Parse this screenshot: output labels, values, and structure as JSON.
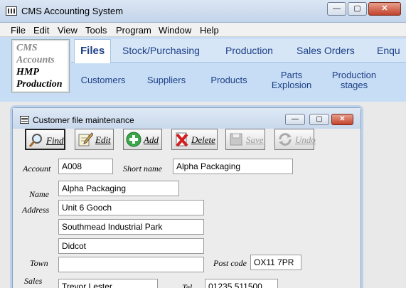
{
  "window": {
    "title": "CMS Accounting System",
    "controls": {
      "minimize": "—",
      "maximize": "▢",
      "close": "✕"
    }
  },
  "menu": [
    "File",
    "Edit",
    "View",
    "Tools",
    "Program",
    "Window",
    "Help"
  ],
  "logo": {
    "line1": "CMS",
    "line2": "Accounts",
    "line3": "HMP",
    "line4": "Production"
  },
  "tabs": [
    "Files",
    "Stock/Purchasing",
    "Production",
    "Sales Orders",
    "Enqu"
  ],
  "subtabs": [
    {
      "label": "Customers"
    },
    {
      "label": "Suppliers"
    },
    {
      "label": "Products"
    },
    {
      "label": "Parts\nExplosion"
    },
    {
      "label": "Production\nstages"
    }
  ],
  "child_window": {
    "title": "Customer file maintenance",
    "controls": {
      "minimize": "—",
      "maximize": "▢",
      "close": "✕"
    }
  },
  "toolbar": {
    "find": "Find",
    "edit": "Edit",
    "add": "Add",
    "delete": "Delete",
    "save": "Save",
    "undo": "Undo"
  },
  "form": {
    "account_label": "Account",
    "account_value": "A008",
    "short_name_label": "Short name",
    "short_name_value": "Alpha Packaging",
    "name_label": "Name",
    "name_value": "Alpha Packaging",
    "address_label": "Address",
    "address1": "Unit 6 Gooch",
    "address2": "Southmead Industrial Park",
    "address3": "Didcot",
    "town_label": "Town",
    "town_value": "",
    "postcode_label": "Post code",
    "postcode_value": "OX11 7PR",
    "sales_label": "Sales",
    "sales_value": "Trevor Lester",
    "tel_label": "Tel",
    "tel_value": "01235 511500"
  },
  "colors": {
    "ribbon": "#c7ddf5",
    "tab_text": "#1c3f86",
    "close_red": "#c2432c"
  }
}
